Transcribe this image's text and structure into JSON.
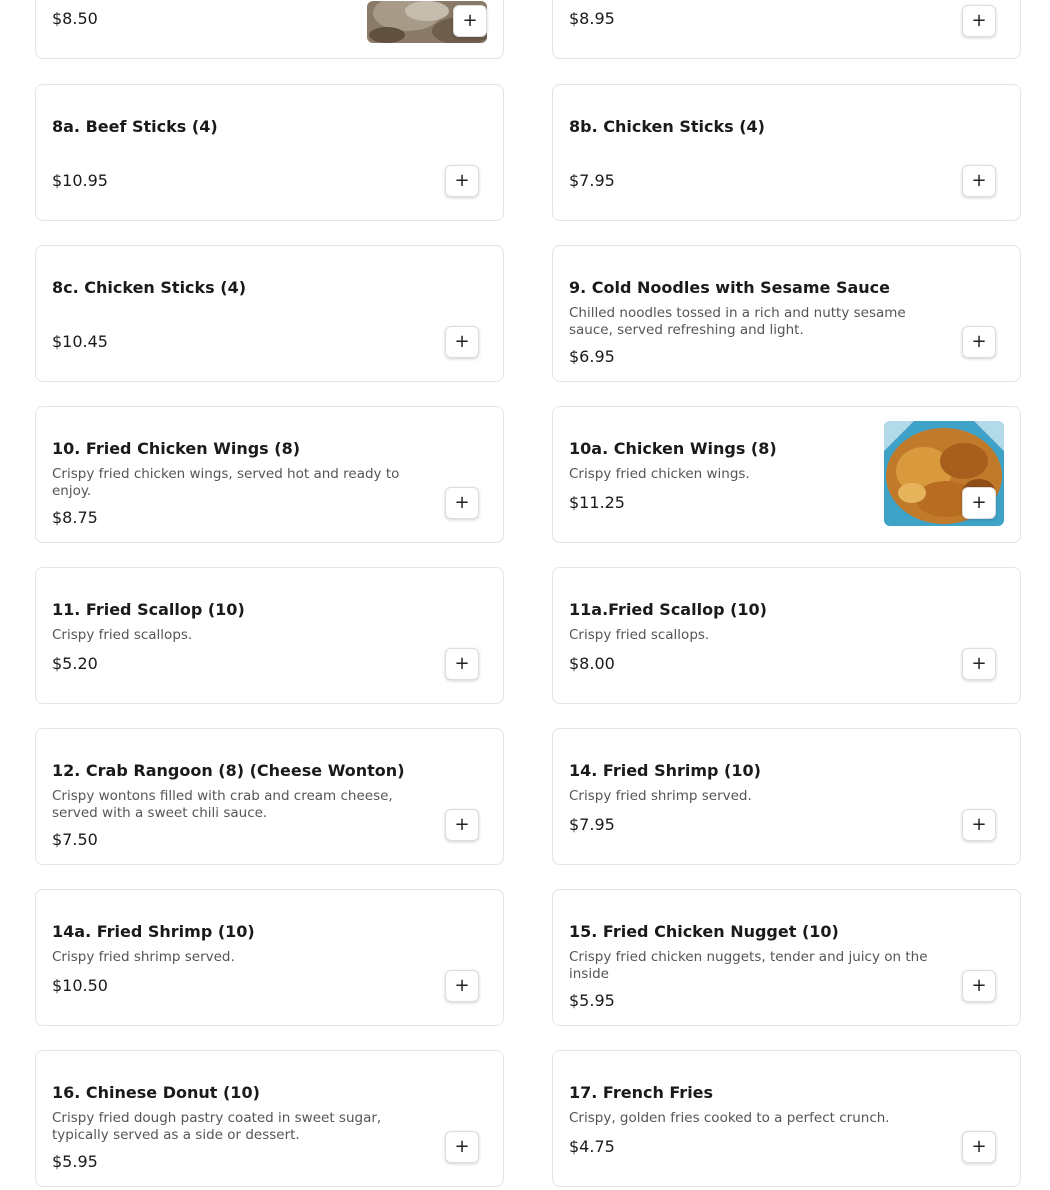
{
  "menu": {
    "add_symbol": "+",
    "items": [
      {
        "price": "$8.50"
      },
      {
        "price": "$8.95"
      },
      {
        "name": "8a. Beef Sticks (4)",
        "price": "$10.95"
      },
      {
        "name": "8b. Chicken Sticks (4)",
        "price": "$7.95"
      },
      {
        "name": "8c. Chicken Sticks (4)",
        "price": "$10.45"
      },
      {
        "name": "9. Cold Noodles with Sesame Sauce",
        "desc": "Chilled noodles tossed in a rich and nutty sesame sauce, served refreshing and light.",
        "price": "$6.95"
      },
      {
        "name": "10. Fried Chicken Wings (8)",
        "desc": "Crispy fried chicken wings, served hot and ready to enjoy.",
        "price": "$8.75"
      },
      {
        "name": "10a. Chicken Wings (8)",
        "desc": "Crispy fried chicken wings.",
        "price": "$11.25"
      },
      {
        "name": "11. Fried Scallop (10)",
        "desc": "Crispy fried scallops.",
        "price": "$5.20"
      },
      {
        "name": "11a.Fried Scallop (10)",
        "desc": "Crispy fried scallops.",
        "price": "$8.00"
      },
      {
        "name": "12. Crab Rangoon (8) (Cheese Wonton)",
        "desc": "Crispy wontons filled with crab and cream cheese, served with a sweet chili sauce.",
        "price": "$7.50"
      },
      {
        "name": "14. Fried Shrimp (10)",
        "desc": "Crispy fried shrimp served.",
        "price": "$7.95"
      },
      {
        "name": "14a. Fried Shrimp (10)",
        "desc": "Crispy fried shrimp served.",
        "price": "$10.50"
      },
      {
        "name": "15. Fried Chicken Nugget (10)",
        "desc": "Crispy fried chicken nuggets, tender and juicy on the inside",
        "price": "$5.95"
      },
      {
        "name": "16. Chinese Donut (10)",
        "desc": "Crispy fried dough pastry coated in sweet sugar, typically served as a side or dessert.",
        "price": "$5.95"
      },
      {
        "name": "17. French Fries",
        "desc": "Crispy, golden fries cooked to a perfect crunch.",
        "price": "$4.75"
      }
    ]
  }
}
